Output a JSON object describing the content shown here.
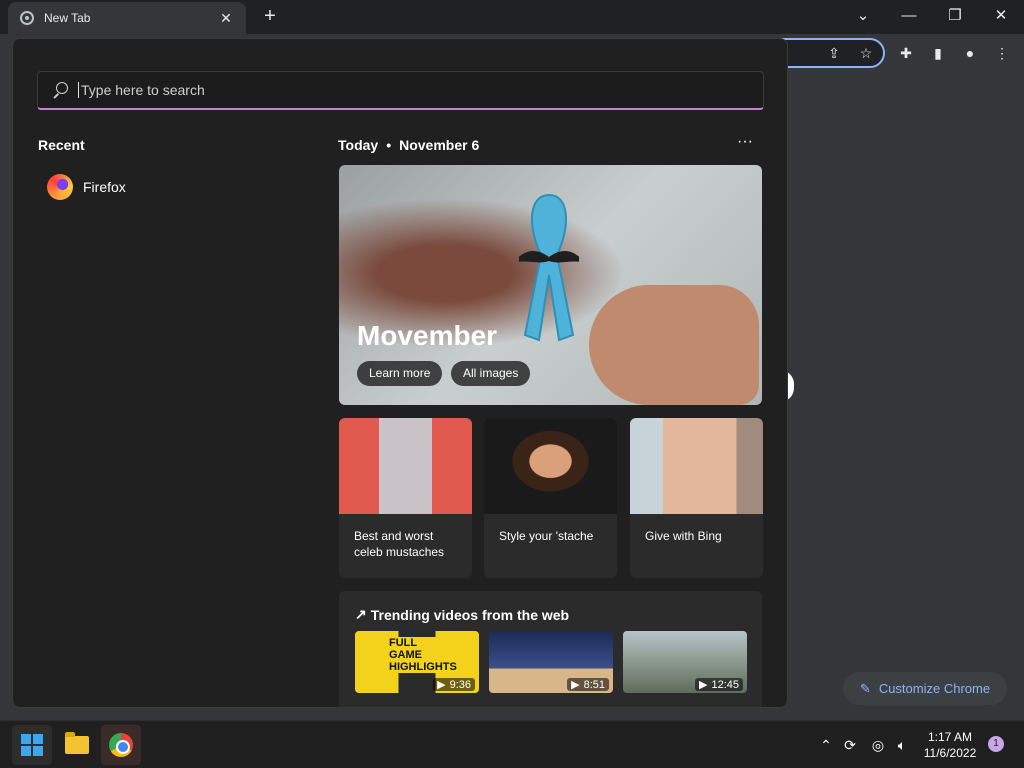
{
  "browser": {
    "tab_title": "New Tab",
    "tab_close": "✕",
    "new_tab": "+",
    "customize_label": "Customize Chrome"
  },
  "search": {
    "placeholder": "Type here to search"
  },
  "recent": {
    "heading": "Recent",
    "items": [
      {
        "label": "Firefox",
        "icon": "firefox-icon"
      }
    ]
  },
  "today": {
    "label": "Today",
    "separator": "•",
    "date": "November 6",
    "more": "···"
  },
  "hero": {
    "title": "Movember",
    "learn_more": "Learn more",
    "all_images": "All images"
  },
  "cards": [
    {
      "text": "Best and worst celeb mustaches"
    },
    {
      "text": "Style your 'stache"
    },
    {
      "text": "Give with Bing"
    }
  ],
  "trending": {
    "title": "Trending videos from the web",
    "videos": [
      {
        "duration": "9:36",
        "overlay": "FULL GAME HIGHLIGHTS"
      },
      {
        "duration": "8:51"
      },
      {
        "duration": "12:45"
      }
    ]
  },
  "taskbar": {
    "time": "1:17 AM",
    "date": "11/6/2022",
    "notifications": "1"
  }
}
